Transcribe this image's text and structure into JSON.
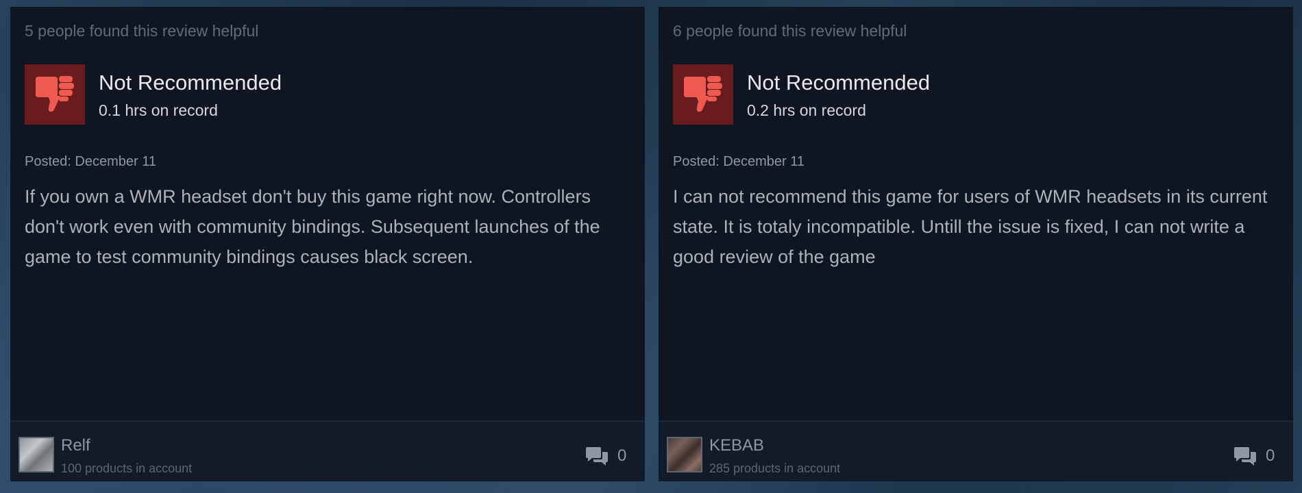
{
  "reviews": [
    {
      "helpful_text": "5 people found this review helpful",
      "verdict": "Not Recommended",
      "hours": "0.1 hrs on record",
      "posted": "Posted: December 11",
      "body": "If you own a WMR headset don't buy this game right now. Controllers don't work even with community bindings. Subsequent launches of the game to test community bindings causes black screen.",
      "author": "Relf",
      "products": "100 products in account",
      "comment_count": "0",
      "icon": "thumbs-down-icon"
    },
    {
      "helpful_text": "6 people found this review helpful",
      "verdict": "Not Recommended",
      "hours": "0.2 hrs on record",
      "posted": "Posted: December 11",
      "body": "I can not recommend this game for users of WMR headsets in its current state. It is totaly incompatible. Untill the issue is fixed, I can not write a good review of the game",
      "author": "KEBAB",
      "products": "285 products in account",
      "comment_count": "0",
      "icon": "thumbs-down-icon"
    }
  ],
  "colors": {
    "card_bg": "#0f1622",
    "thumb_bg": "#6a1b1d",
    "thumb_fg": "#ef5a50",
    "verdict_text": "#e8ebee",
    "body_text": "#acb2b8"
  }
}
